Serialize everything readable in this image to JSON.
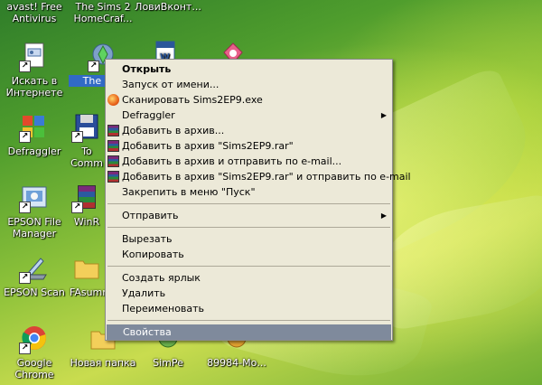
{
  "desktop": {
    "icons": [
      {
        "label": "avast! Free Antivirus",
        "icon": "avast-icon"
      },
      {
        "label": "The Sims 2 HomeCraf...",
        "icon": "sims-icon"
      },
      {
        "label": "ЛовиВконт...",
        "icon": "vk-icon"
      },
      {
        "label": "Искать в Интернете",
        "icon": "search-document-icon"
      },
      {
        "label": "The Sim",
        "icon": "sims-plumbob-icon"
      },
      {
        "label": "Defraggler",
        "icon": "defraggler-icon"
      },
      {
        "label": "To Comm",
        "icon": "floppy-icon"
      },
      {
        "label": "EPSON File Manager",
        "icon": "epson-file-manager-icon"
      },
      {
        "label": "WinR",
        "icon": "winrar-icon"
      },
      {
        "label": "EPSON Scan",
        "icon": "epson-scan-icon"
      },
      {
        "label": "FAsumm",
        "icon": "folder-icon"
      },
      {
        "label": "Google Chrome",
        "icon": "chrome-icon"
      },
      {
        "label": "Новая папка",
        "icon": "folder-icon"
      },
      {
        "label": "SimPe",
        "icon": "simpe-icon"
      },
      {
        "label": "89984-Мо...",
        "icon": "file-icon"
      }
    ]
  },
  "menu": {
    "items": [
      {
        "label": "Открыть",
        "bold": true
      },
      {
        "label": "Запуск от имени..."
      },
      {
        "label": "Сканировать Sims2EP9.exe",
        "icon": "avast-icon"
      },
      {
        "label": "Defraggler",
        "submenu": true
      },
      {
        "label": "Добавить в архив...",
        "icon": "winrar-icon"
      },
      {
        "label": "Добавить в архив \"Sims2EP9.rar\"",
        "icon": "winrar-icon"
      },
      {
        "label": "Добавить в архив и отправить по e-mail...",
        "icon": "winrar-icon"
      },
      {
        "label": "Добавить в архив \"Sims2EP9.rar\" и отправить по e-mail",
        "icon": "winrar-icon"
      },
      {
        "label": "Закрепить в меню \"Пуск\""
      },
      {
        "label": "Отправить",
        "submenu": true
      },
      {
        "label": "Вырезать"
      },
      {
        "label": "Копировать"
      },
      {
        "label": "Создать ярлык"
      },
      {
        "label": "Удалить"
      },
      {
        "label": "Переименовать"
      },
      {
        "label": "Свойства",
        "highlighted": true
      }
    ],
    "submenu_arrow": "▶"
  },
  "colors": {
    "menu_bg": "#ece9d8",
    "menu_highlight": "#7f8a9c",
    "selection": "#316ac5"
  }
}
